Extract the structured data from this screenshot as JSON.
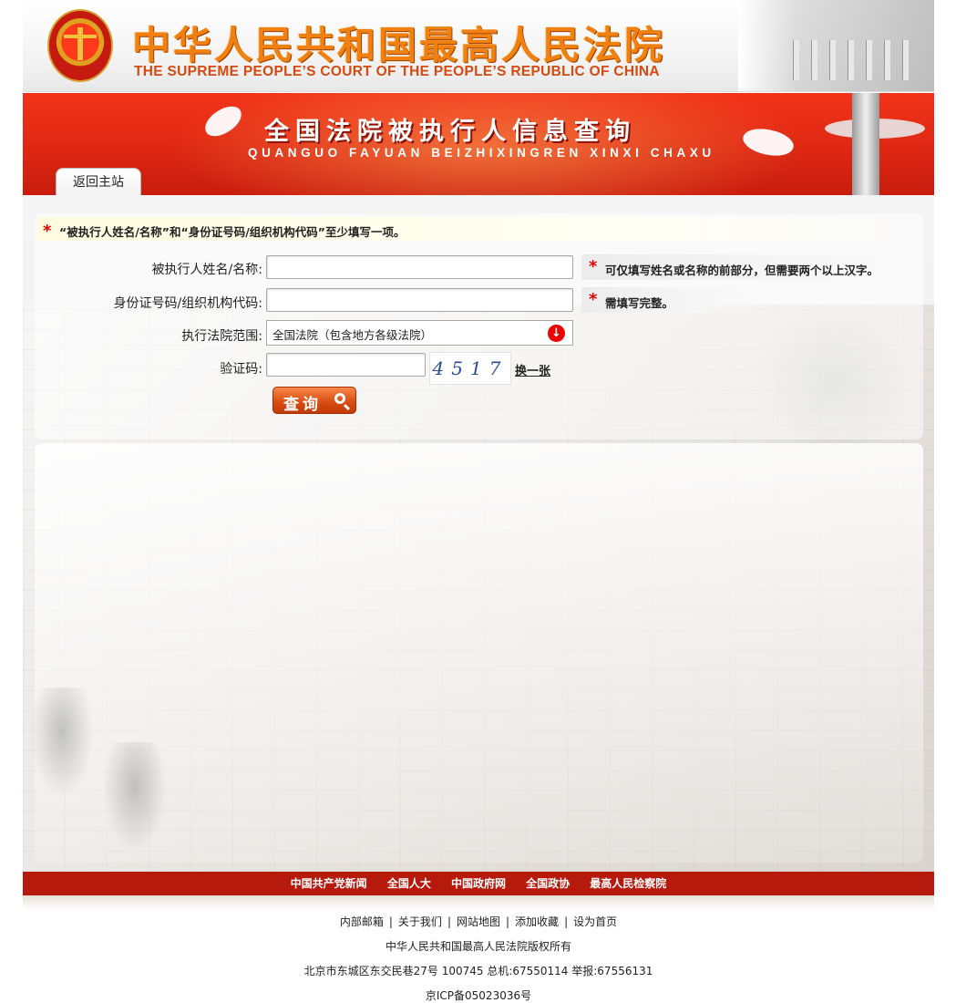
{
  "header": {
    "title_cn": "中华人民共和国最高人民法院",
    "title_en": "THE SUPREME PEOPLE’S COURT OF THE PEOPLE’S REPUBLIC OF CHINA"
  },
  "banner": {
    "title_cn": "全国法院被执行人信息查询",
    "title_en": "QUANGUO FAYUAN BEIZHIXINGREN XINXI CHAXU",
    "back_tab": "返回主站"
  },
  "form": {
    "notice": "“被执行人姓名/名称”和“身份证号码/组织机构代码”至少填写一项。",
    "name_label": "被执行人姓名/名称:",
    "name_value": "",
    "name_hint": "可仅填写姓名或名称的前部分，但需要两个以上汉字。",
    "id_label": "身份证号码/组织机构代码:",
    "id_value": "",
    "id_hint": "需填写完整。",
    "court_label": "执行法院范围:",
    "court_value": "全国法院（包含地方各级法院）",
    "captcha_label": "验证码:",
    "captcha_value": "",
    "captcha_image_text": "4517",
    "refresh_label": "换一张",
    "search_button": "查询"
  },
  "footer": {
    "nav_links": [
      "中国共产党新闻",
      "全国人大",
      "中国政府网",
      "全国政协",
      "最高人民检察院"
    ],
    "links": [
      "内部邮箱",
      "关于我们",
      "网站地图",
      "添加收藏",
      "设为首页"
    ],
    "copyright": "中华人民共和国最高人民法院版权所有",
    "address": "北京市东城区东交民巷27号 100745 总机:67550114 举报:67556131",
    "icp": "京ICP备05023036号"
  },
  "colors": {
    "banner_red": "#e22a14",
    "nav_red": "#b51a0c",
    "title_orange": "#f08010",
    "required_star": "#e00000",
    "captcha_blue": "#2a4a9a"
  },
  "icons": {
    "required": "star-icon",
    "dropdown": "down-arrow-circle-icon",
    "search": "magnifier-icon"
  }
}
